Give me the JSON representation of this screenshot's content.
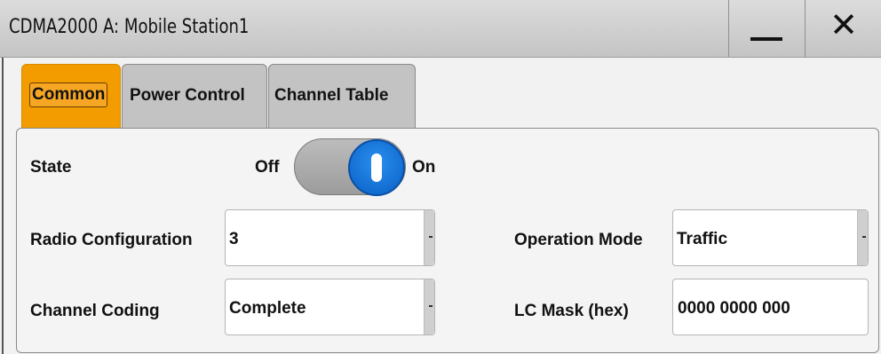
{
  "window": {
    "title": "CDMA2000 A:  Mobile Station1",
    "minimize_icon": "minimize-icon",
    "close_icon": "close-icon",
    "close_glyph": "✕"
  },
  "tabs": [
    {
      "label": "Common",
      "active": true
    },
    {
      "label": "Power Control",
      "active": false
    },
    {
      "label": "Channel Table",
      "active": false
    }
  ],
  "state": {
    "label": "State",
    "off_label": "Off",
    "on_label": "On",
    "value": "On"
  },
  "radio_configuration": {
    "label": "Radio Configuration",
    "value": "3"
  },
  "operation_mode": {
    "label": "Operation Mode",
    "value": "Traffic"
  },
  "channel_coding": {
    "label": "Channel Coding",
    "value": "Complete"
  },
  "lc_mask": {
    "label": "LC Mask (hex)",
    "value": "0000 0000 000"
  },
  "colors": {
    "active_tab": "#f29c00",
    "toggle_on": "#0a6fd8",
    "titlebar": "#d0d0d0"
  }
}
